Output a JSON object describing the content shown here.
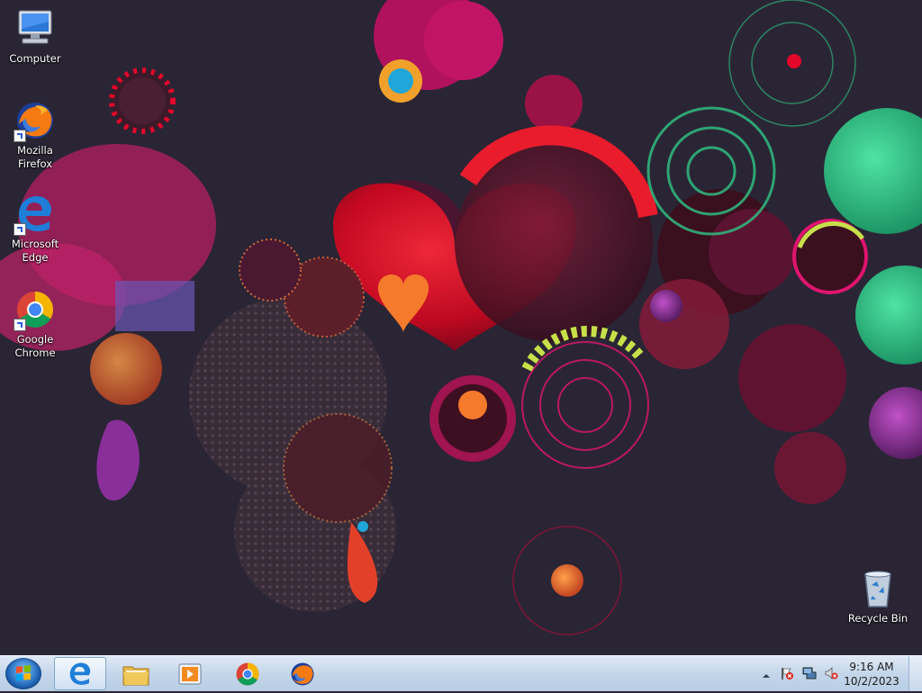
{
  "desktop": {
    "icons": [
      {
        "label_line1": "Computer",
        "label_line2": "",
        "icon": "computer-icon"
      },
      {
        "label_line1": "Mozilla",
        "label_line2": "Firefox",
        "icon": "firefox-icon"
      },
      {
        "label_line1": "Microsoft",
        "label_line2": "Edge",
        "icon": "edge-icon"
      },
      {
        "label_line1": "Google",
        "label_line2": "Chrome",
        "icon": "chrome-icon"
      },
      {
        "label_line1": "Recycle Bin",
        "label_line2": "",
        "icon": "recycle-bin-icon"
      }
    ]
  },
  "taskbar": {
    "pinned": [
      {
        "icon": "edge-icon",
        "active": true
      },
      {
        "icon": "file-explorer-icon",
        "active": false
      },
      {
        "icon": "media-player-icon",
        "active": false
      },
      {
        "icon": "chrome-icon",
        "active": false
      },
      {
        "icon": "firefox-icon",
        "active": false
      }
    ],
    "tray": {
      "icons": [
        "show-hidden-icons-icon",
        "action-center-flag-icon",
        "network-icon",
        "volume-muted-icon"
      ],
      "time": "9:16 AM",
      "date": "10/2/2023"
    }
  },
  "colors": {
    "background": "#2a2534",
    "magenta": "#e0156f",
    "red": "#e3082a",
    "orange": "#f57a2c",
    "green": "#2fc486",
    "purple": "#8a2f9a",
    "taskbar": "#c4d6ea"
  }
}
